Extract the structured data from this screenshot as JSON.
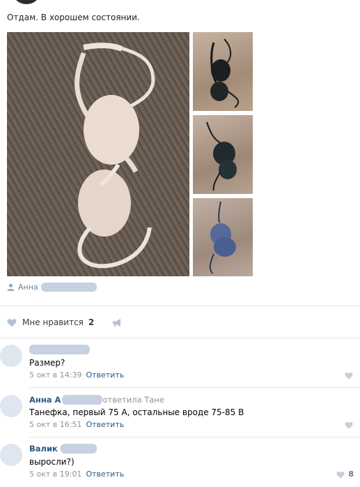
{
  "post": {
    "text": "Отдам. В хорошем состоянии.",
    "author": "Анна"
  },
  "likes": {
    "label": "Мне нравится",
    "count": "2"
  },
  "comments": [
    {
      "name": "",
      "text": "Размер?",
      "date": "5 окт в 14:39",
      "reply": "Ответить",
      "likes": ""
    },
    {
      "name": "Анна А",
      "reply_to": "ответила Тане",
      "text": "Танефка, первый 75 А, остальные вроде 75-85 В",
      "date": "5 окт в 16:51",
      "reply": "Ответить",
      "likes": ""
    },
    {
      "name": "Валик",
      "text": "выросли?)",
      "date": "5 окт в 19:01",
      "reply": "Ответить",
      "likes": "8"
    }
  ],
  "colors": {
    "link": "#2a5885",
    "meta": "#939393",
    "blur": "#c6d1e2"
  }
}
